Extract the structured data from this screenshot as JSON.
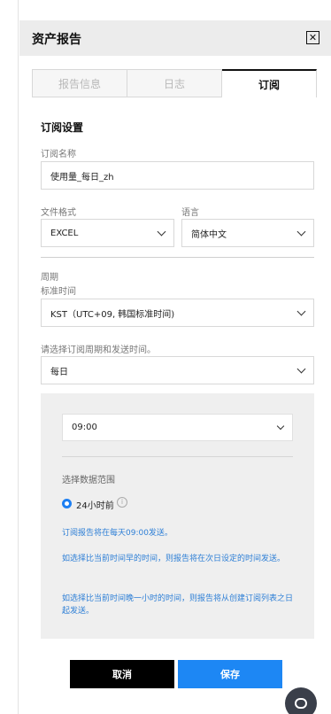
{
  "panel": {
    "title": "资产报告"
  },
  "tabs": [
    {
      "label": "报告信息"
    },
    {
      "label": "日志"
    },
    {
      "label": "订阅"
    }
  ],
  "subscription": {
    "section_title": "订阅设置",
    "name_label": "订阅名称",
    "name_value": "使用量_每日_zh",
    "format_label": "文件格式",
    "format_value": "EXCEL",
    "language_label": "语言",
    "language_value": "简体中文",
    "period_label": "周期",
    "timezone_label": "标准时间",
    "timezone_value": "KST（UTC+09, 韩国标准时间)",
    "schedule_label": "请选择订阅周期和发送时间。",
    "schedule_value": "每日"
  },
  "schedule_box": {
    "time_value": "09:00",
    "range_label": "选择数据范围",
    "range_option": "24小时前",
    "info_icon_glyph": "i",
    "note1": "订阅报告将在每天09:00发送。",
    "note2": "如选择比当前时间早的时间，则报告将在次日设定的时间发送。",
    "note3": "如选择比当前时间晚一小时的时间，则报告将从创建订阅列表之日起发送。"
  },
  "buttons": {
    "cancel": "取消",
    "save": "保存"
  },
  "icons": {
    "close": "close-icon",
    "chevron": "chevron-down-icon",
    "info": "info-icon",
    "chat": "chat-icon"
  },
  "colors": {
    "accent": "#1d87f4",
    "note_text": "#2e7fd6",
    "header_bg": "#ececec"
  }
}
